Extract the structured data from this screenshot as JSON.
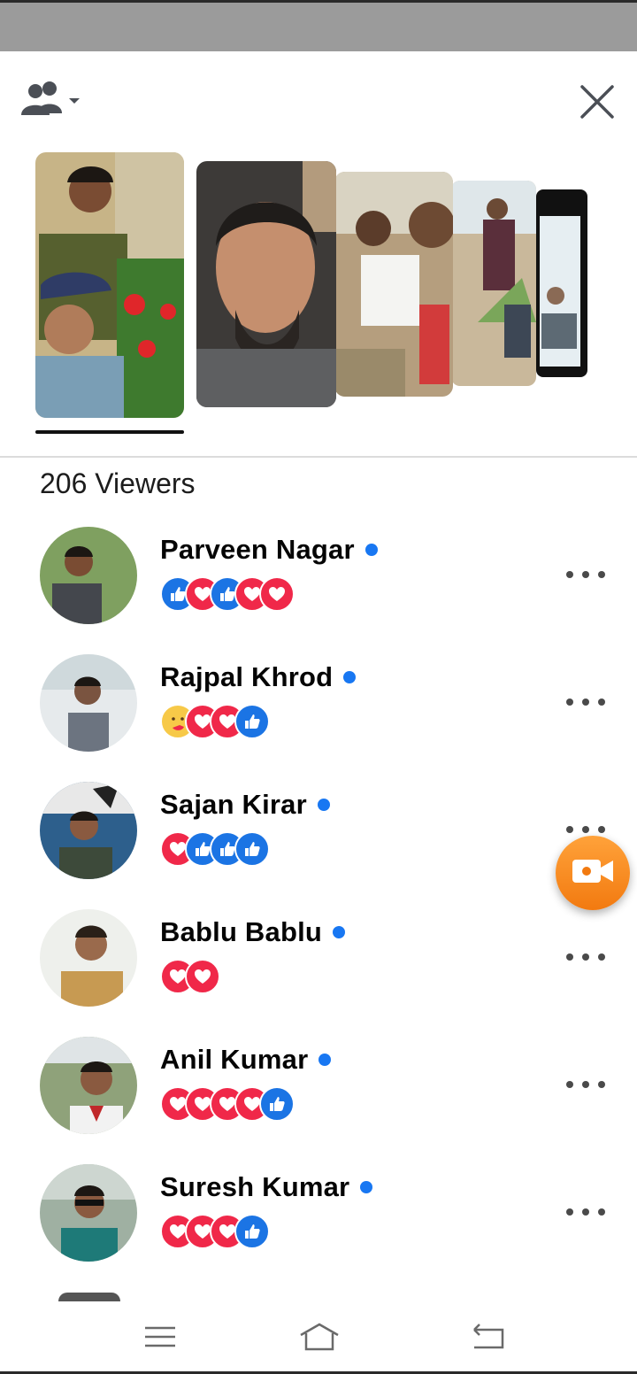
{
  "header": {
    "audience_icon": "people-icon",
    "close_icon": "close-icon"
  },
  "viewers_label": "206 Viewers",
  "viewers": [
    {
      "name": "Parveen Nagar",
      "online": true,
      "reactions": [
        "like",
        "love",
        "like",
        "love",
        "love"
      ]
    },
    {
      "name": "Rajpal Khrod",
      "online": true,
      "reactions": [
        "care",
        "love",
        "love",
        "like"
      ]
    },
    {
      "name": "Sajan Kirar",
      "online": true,
      "reactions": [
        "love",
        "like",
        "like",
        "like"
      ]
    },
    {
      "name": "Bablu Bablu",
      "online": true,
      "reactions": [
        "love",
        "love"
      ]
    },
    {
      "name": "Anil Kumar",
      "online": true,
      "reactions": [
        "love",
        "love",
        "love",
        "love",
        "like"
      ]
    },
    {
      "name": "Suresh Kumar",
      "online": true,
      "reactions": [
        "love",
        "love",
        "love",
        "like"
      ]
    }
  ],
  "colors": {
    "like": "#1b74e4",
    "love": "#f02849",
    "care": "#f7c948",
    "online_dot": "#1877f2",
    "fab": "#f27a10"
  },
  "fab_icon": "video-camera-icon",
  "nav": {
    "menu_icon": "menu-icon",
    "home_icon": "home-icon",
    "back_icon": "back-icon"
  }
}
